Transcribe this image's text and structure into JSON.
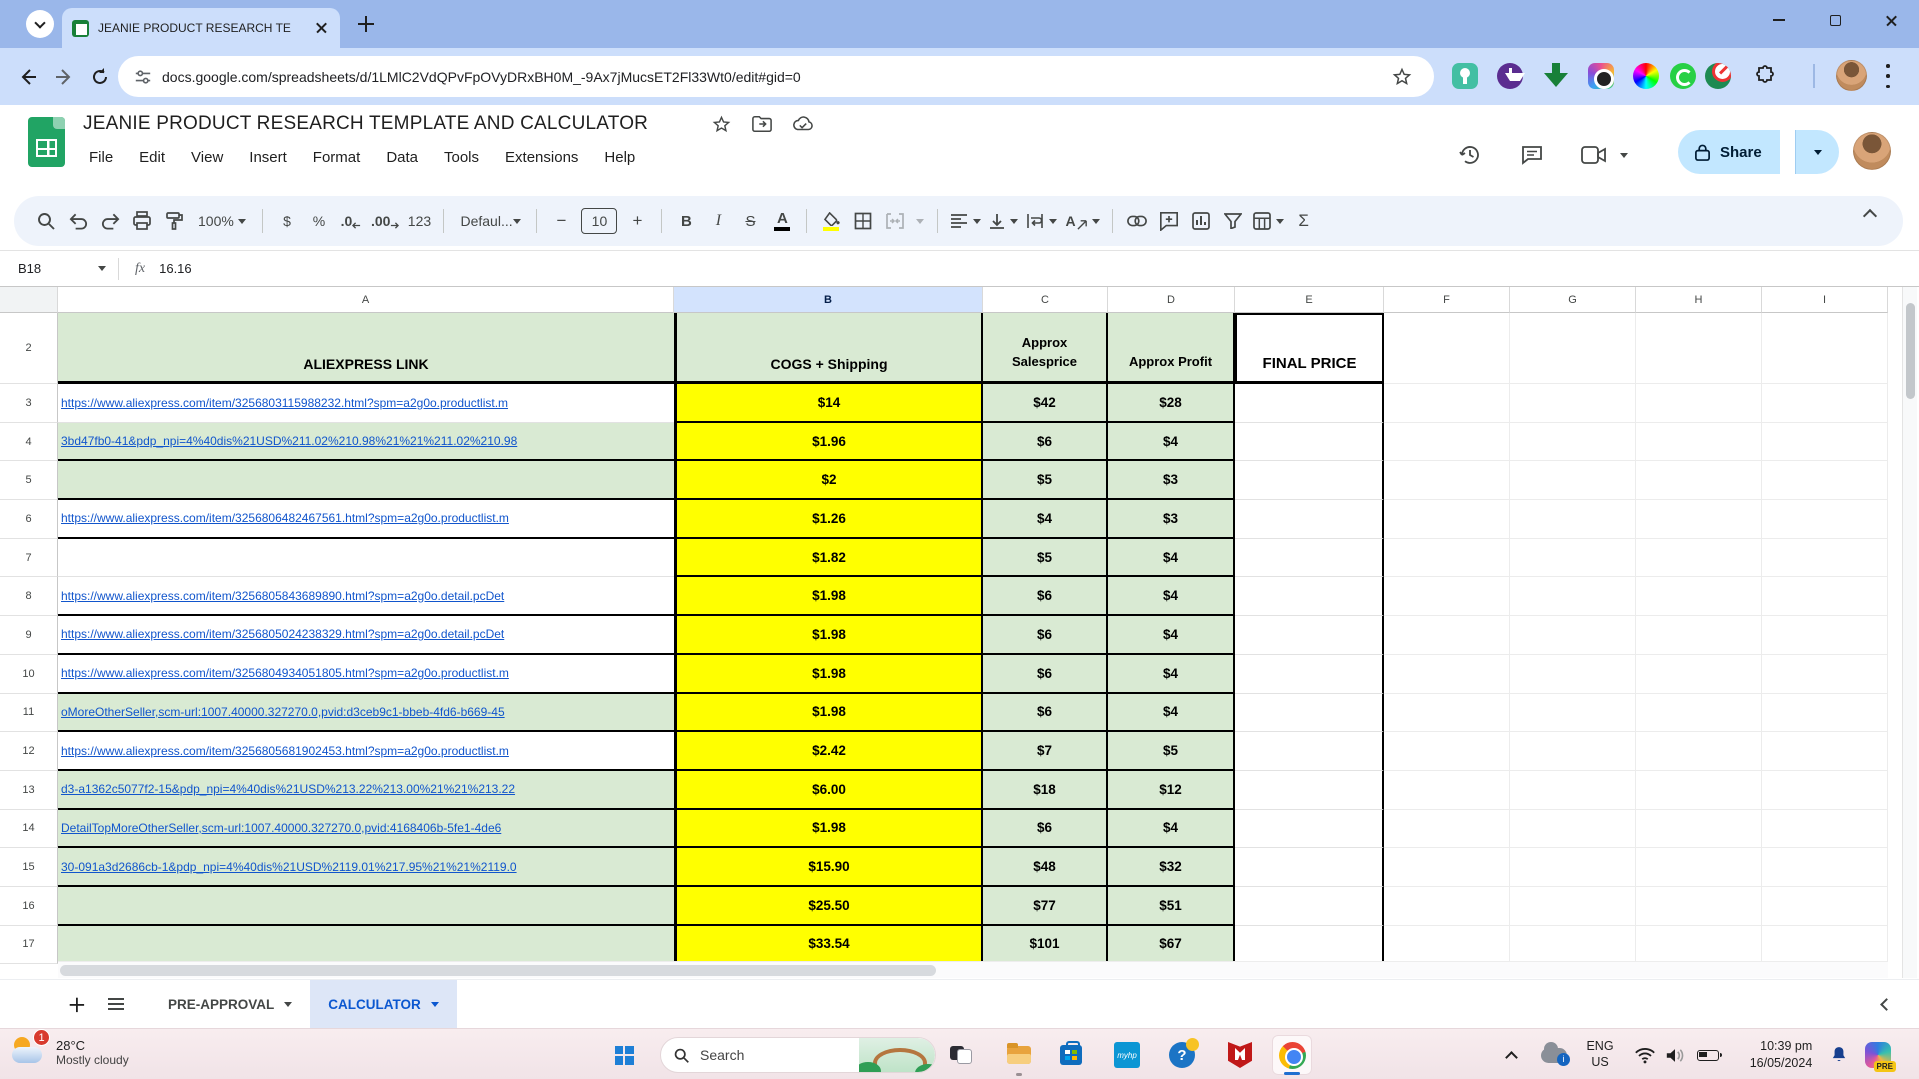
{
  "browser": {
    "tab_title": "JEANIE PRODUCT RESEARCH TE",
    "url": "docs.google.com/spreadsheets/d/1LMlC2VdQPvFpOVyDRxBH0M_-9Ax7jMucsET2Fl33Wt0/edit#gid=0"
  },
  "header": {
    "title": "JEANIE PRODUCT RESEARCH TEMPLATE AND CALCULATOR",
    "menus": [
      "File",
      "Edit",
      "View",
      "Insert",
      "Format",
      "Data",
      "Tools",
      "Extensions",
      "Help"
    ],
    "share_label": "Share"
  },
  "toolbar": {
    "zoom": "100%",
    "currency": "$",
    "percent": "%",
    "decrease_decimal": ".0",
    "increase_decimal": ".00",
    "format_123": "123",
    "font_name": "Defaul...",
    "font_size": "10",
    "minus": "−",
    "plus": "+",
    "bold": "B",
    "italic": "I",
    "strikethrough": "S",
    "text_color": "A",
    "text_rotation": "A",
    "sigma": "Σ"
  },
  "formula_bar": {
    "cell_ref": "B18",
    "fx_label": "fx",
    "value": "16.16"
  },
  "grid": {
    "selected_column": "B",
    "columns": [
      "A",
      "B",
      "C",
      "D",
      "E",
      "F",
      "G",
      "H",
      "I"
    ],
    "header_row": {
      "n": "2",
      "a": "ALIEXPRESS LINK",
      "b": "COGS + Shipping",
      "c": "Approx Salesprice",
      "d": "Approx Profit",
      "e": "FINAL PRICE"
    },
    "rows": [
      {
        "n": "3",
        "a": "https://www.aliexpress.com/item/3256803115988232.html?spm=a2g0o.productlist.m",
        "link": true,
        "bg": "white",
        "thick": false,
        "b": "$14",
        "c": "$42",
        "d": "$28"
      },
      {
        "n": "4",
        "a": "3bd47fb0-41&pdp_npi=4%40dis%21USD%211.02%210.98%21%21%211.02%210.98",
        "link": true,
        "bg": "green",
        "thick": true,
        "b": "$1.96",
        "c": "$6",
        "d": "$4"
      },
      {
        "n": "5",
        "a": "",
        "link": false,
        "bg": "green",
        "thick": true,
        "b": "$2",
        "c": "$5",
        "d": "$3"
      },
      {
        "n": "6",
        "a": "https://www.aliexpress.com/item/3256806482467561.html?spm=a2g0o.productlist.m",
        "link": true,
        "bg": "white",
        "thick": true,
        "b": "$1.26",
        "c": "$4",
        "d": "$3"
      },
      {
        "n": "7",
        "a": "",
        "link": false,
        "bg": "white",
        "thick": false,
        "b": "$1.82",
        "c": "$5",
        "d": "$4"
      },
      {
        "n": "8",
        "a": "https://www.aliexpress.com/item/3256805843689890.html?spm=a2g0o.detail.pcDet",
        "link": true,
        "bg": "white",
        "thick": true,
        "b": "$1.98",
        "c": "$6",
        "d": "$4"
      },
      {
        "n": "9",
        "a": "https://www.aliexpress.com/item/3256805024238329.html?spm=a2g0o.detail.pcDet",
        "link": true,
        "bg": "white",
        "thick": true,
        "b": "$1.98",
        "c": "$6",
        "d": "$4"
      },
      {
        "n": "10",
        "a": "https://www.aliexpress.com/item/3256804934051805.html?spm=a2g0o.productlist.m",
        "link": true,
        "bg": "white",
        "thick": true,
        "b": "$1.98",
        "c": "$6",
        "d": "$4"
      },
      {
        "n": "11",
        "a": "oMoreOtherSeller,scm-url:1007.40000.327270.0,pvid:d3ceb9c1-bbeb-4fd6-b669-45",
        "link": true,
        "bg": "green",
        "thick": true,
        "b": "$1.98",
        "c": "$6",
        "d": "$4"
      },
      {
        "n": "12",
        "a": "https://www.aliexpress.com/item/3256805681902453.html?spm=a2g0o.productlist.m",
        "link": true,
        "bg": "white",
        "thick": true,
        "b": "$2.42",
        "c": "$7",
        "d": "$5"
      },
      {
        "n": "13",
        "a": "d3-a1362c5077f2-15&pdp_npi=4%40dis%21USD%213.22%213.00%21%21%213.22",
        "link": true,
        "bg": "green",
        "thick": true,
        "b": "$6.00",
        "c": "$18",
        "d": "$12"
      },
      {
        "n": "14",
        "a": "DetailTopMoreOtherSeller,scm-url:1007.40000.327270.0,pvid:4168406b-5fe1-4de6",
        "link": true,
        "bg": "green",
        "thick": true,
        "b": "$1.98",
        "c": "$6",
        "d": "$4"
      },
      {
        "n": "15",
        "a": "30-091a3d2686cb-1&pdp_npi=4%40dis%21USD%2119.01%217.95%21%21%2119.0",
        "link": true,
        "bg": "green",
        "thick": true,
        "b": "$15.90",
        "c": "$48",
        "d": "$32"
      },
      {
        "n": "16",
        "a": "",
        "link": false,
        "bg": "green",
        "thick": true,
        "b": "$25.50",
        "c": "$77",
        "d": "$51"
      },
      {
        "n": "17",
        "a": "",
        "link": false,
        "bg": "green",
        "thick": true,
        "b": "$33.54",
        "c": "$101",
        "d": "$67"
      }
    ]
  },
  "sheet_tabs": {
    "pre_approval": "PRE-APPROVAL",
    "calculator": "CALCULATOR"
  },
  "taskbar": {
    "weather_badge": "1",
    "weather_temp": "28°C",
    "weather_desc": "Mostly cloudy",
    "search_placeholder": "Search",
    "myhp_label": "myhp",
    "help_glyph": "?",
    "onedrive_glyph": "i",
    "lang_line1": "ENG",
    "lang_line2": "US",
    "time": "10:39 pm",
    "date": "16/05/2024",
    "copilot_badge": "PRE"
  },
  "colors": {
    "cell_green": "#d9ead3",
    "cell_yellow": "#ffff00",
    "link_blue": "#1155cc",
    "accent_blue": "#0b57d0",
    "share_pill": "#c2e7ff"
  }
}
